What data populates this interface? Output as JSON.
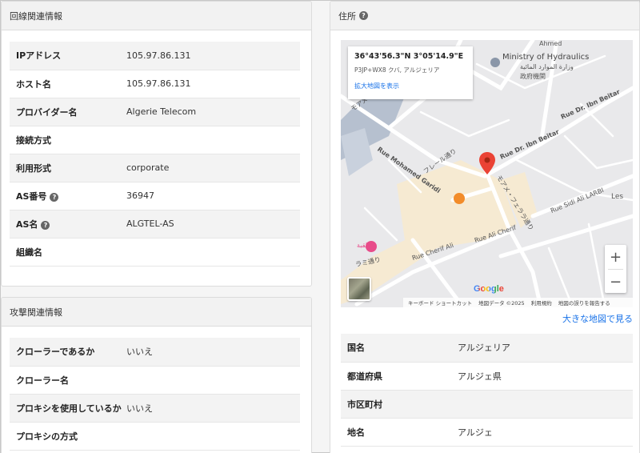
{
  "line_info": {
    "header": "回線関連情報",
    "rows": [
      {
        "label": "IPアドレス",
        "value": "105.97.86.131",
        "help": false
      },
      {
        "label": "ホスト名",
        "value": "105.97.86.131",
        "help": false
      },
      {
        "label": "プロバイダー名",
        "value": "Algerie Telecom",
        "help": false
      },
      {
        "label": "接続方式",
        "value": "",
        "help": false
      },
      {
        "label": "利用形式",
        "value": "corporate",
        "help": false
      },
      {
        "label": "AS番号",
        "value": "36947",
        "help": true
      },
      {
        "label": "AS名",
        "value": "ALGTEL-AS",
        "help": true
      },
      {
        "label": "組織名",
        "value": "",
        "help": false
      }
    ]
  },
  "attack_info": {
    "header": "攻撃関連情報",
    "rows": [
      {
        "label": "クローラーであるか",
        "value": "いいえ"
      },
      {
        "label": "クローラー名",
        "value": ""
      },
      {
        "label": "プロキシを使用しているか",
        "value": "いいえ"
      },
      {
        "label": "プロキシの方式",
        "value": ""
      }
    ]
  },
  "address": {
    "header": "住所",
    "larger_map_link": "大きな地図で見る",
    "rows": [
      {
        "label": "国名",
        "value": "アルジェリア"
      },
      {
        "label": "都道府県",
        "value": "アルジェ県"
      },
      {
        "label": "市区町村",
        "value": ""
      },
      {
        "label": "地名",
        "value": "アルジェ"
      }
    ]
  },
  "map": {
    "coords": "36°43'56.3\"N 3°05'14.9\"E",
    "plus_code": "P3JP+WX8 クバ, アルジェリア",
    "enlarge_link": "拡大地図を表示",
    "google": "Google",
    "attribution": [
      "キーボード ショートカット",
      "地図データ ©2025",
      "利用規約",
      "地図の誤りを報告する"
    ],
    "labels": {
      "ministry": "Ministry of Hydraulics",
      "ministry_ar": "وزارة الموارد المائية",
      "gov": "政府機関",
      "road1": "Rue Dr. Ibn Beitar",
      "road2": "Rue Dr. Ibn Beitar",
      "road3": "Rue Mohamed Garidi",
      "road4": "フレール通り",
      "road5": "モアメ・フェララ通り",
      "road6": "Rue Ali Cherif",
      "road7": "Rue Cherif Ali",
      "road8": "Rue Sidi Ali LARBI",
      "road9": "ラミ通り",
      "road10": "モアメ・ラ",
      "ahmed": "Ahmed",
      "les": "Les",
      "arabic_shop": "القبة"
    },
    "accent_color": "#1a73e8",
    "pin_color": "#ea4335"
  }
}
